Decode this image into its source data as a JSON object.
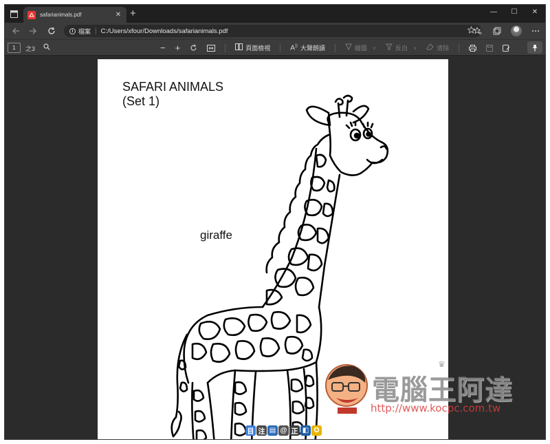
{
  "tab": {
    "title": "safarianimals.pdf",
    "close": "✕",
    "new_tab": "+"
  },
  "window_controls": {
    "minimize": "—",
    "maximize": "☐",
    "close": "✕"
  },
  "address": {
    "file_label": "檔案",
    "url": "C:/Users/xfour/Downloads/safarianimals.pdf"
  },
  "pdf_toolbar": {
    "page": "1",
    "total": "之3",
    "zoom_out": "−",
    "zoom_in": "+",
    "page_view": "頁面檢視",
    "read_aloud": "大聲朗讀",
    "draw": "繪圖",
    "highlight": "反白",
    "erase": "清除"
  },
  "document": {
    "title_line1": "SAFARI ANIMALS",
    "title_line2": "(Set 1)",
    "animal_label": "giraffe"
  },
  "watermark": {
    "brand": "電腦王阿達",
    "url": "http://www.kocpc.com.tw"
  },
  "colors": {
    "accent": "#e53935",
    "chrome_dark": "#1f1f1f",
    "chrome_mid": "#3b3b3b",
    "viewport": "#2b2b2b"
  }
}
